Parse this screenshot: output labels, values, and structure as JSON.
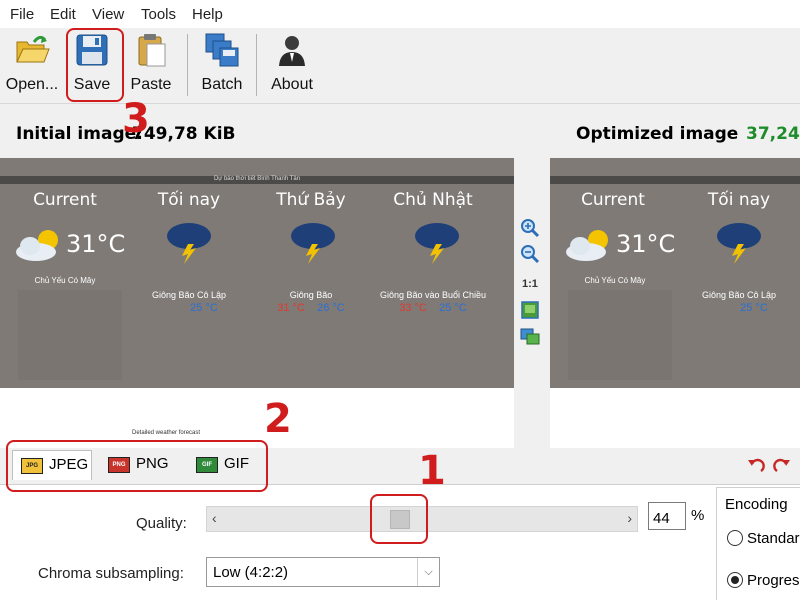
{
  "menu": {
    "items": [
      "File",
      "Edit",
      "View",
      "Tools",
      "Help"
    ]
  },
  "toolbar": {
    "open_label": "Open...",
    "save_label": "Save",
    "paste_label": "Paste",
    "batch_label": "Batch",
    "about_label": "About"
  },
  "image_info": {
    "initial_label": "Initial image:",
    "initial_size": "749,78 KiB",
    "optimized_label": "Optimized image",
    "optimized_size": "37,24"
  },
  "preview": {
    "window_title": "Dự báo thời tiết Bình Thanh Tân",
    "columns": [
      {
        "heading": "Current"
      },
      {
        "heading": "Tối nay",
        "desc": "Giông Bão Cô Lập",
        "hi": "",
        "lo": "25 °C"
      },
      {
        "heading": "Thứ Bảy",
        "desc": "Giông Bão",
        "hi": "31 °C",
        "lo": "26 °C"
      },
      {
        "heading": "Chủ Nhật",
        "desc": "Giông Bão vào Buổi Chiều",
        "hi": "33 °C",
        "lo": "25 °C"
      }
    ],
    "current_temp": "31°C",
    "current_desc": "Chủ Yếu Có Mây",
    "zoom_ratio": "1:1",
    "detailed_link": "Detailed weather forecast"
  },
  "tabs": [
    {
      "label": "JPEG",
      "icon": "JPG"
    },
    {
      "label": "PNG",
      "icon": "PNG"
    },
    {
      "label": "GIF",
      "icon": "GIF"
    }
  ],
  "settings": {
    "quality_label": "Quality:",
    "quality_value": "44",
    "quality_percent": 44,
    "percent_sign": "%",
    "chroma_label": "Chroma subsampling:",
    "chroma_value": "Low (4:2:2)",
    "encoding_title": "Encoding",
    "encoding_options": [
      "Standard",
      "Progressive"
    ]
  },
  "annotations": {
    "step1": "1",
    "step2": "2",
    "step3": "3",
    "color": "#d01c1c"
  },
  "colors": {
    "optimized_size": "#1e8c2a",
    "hi_temp": "#e0392f",
    "lo_temp": "#2a6fd6"
  }
}
